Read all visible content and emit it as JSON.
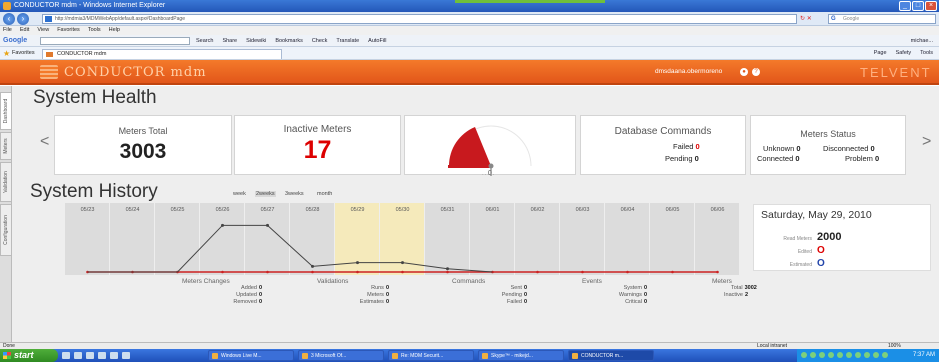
{
  "window": {
    "title": "CONDUCTOR mdm - Windows Internet Explorer"
  },
  "browser": {
    "address": "http://mdmia3/MDMWebApp/default.aspx#DashboardPage",
    "search_placeholder": "Google",
    "menu": [
      "File",
      "Edit",
      "View",
      "Favorites",
      "Tools",
      "Help"
    ],
    "toolbar_logo": "Google",
    "toolbar_items": [
      "Search",
      "Share",
      "Sidewiki",
      "Bookmarks",
      "Check",
      "Translate",
      "AutoFill"
    ],
    "toolbar_user": "michae...",
    "favorites_label": "Favorites",
    "tab_title": "CONDUCTOR mdm",
    "command_items": [
      "Page",
      "Safety",
      "Tools"
    ]
  },
  "app": {
    "brand": "CONDUCTOR mdm",
    "user": "dmsdaana.obermoreno",
    "vendor": "TELVENT",
    "sidebar_tabs": [
      "Dashboard",
      "Meters",
      "Validation",
      "Configuration"
    ]
  },
  "health": {
    "title": "System Health",
    "prev": "<",
    "next": ">",
    "meters_total_label": "Meters Total",
    "meters_total": "3003",
    "inactive_label": "Inactive Meters",
    "inactive": "17",
    "gauge_value": "0",
    "db_label": "Database Commands",
    "db_failed_label": "Failed",
    "db_failed": "0",
    "db_pending_label": "Pending",
    "db_pending": "0",
    "status_label": "Meters Status",
    "unknown_label": "Unknown",
    "unknown": "0",
    "disconnected_label": "Disconnected",
    "disconnected": "0",
    "connected_label": "Connected",
    "connected": "0",
    "problem_label": "Problem",
    "problem": "0"
  },
  "history": {
    "title": "System History",
    "ranges": [
      "week",
      "2weeks",
      "3weeks",
      "month"
    ],
    "active_range": "2weeks",
    "dots": "....."
  },
  "chart_data": {
    "type": "line",
    "x": [
      "05/23",
      "05/24",
      "05/25",
      "05/26",
      "05/27",
      "05/28",
      "05/29",
      "05/30",
      "05/31",
      "06/01",
      "06/02",
      "06/03",
      "06/04",
      "06/05",
      "06/06"
    ],
    "series": [
      {
        "values": [
          0,
          0,
          0,
          5,
          5,
          0.6,
          1,
          1,
          0.35,
          0,
          0,
          0,
          0,
          0,
          0
        ]
      },
      {
        "values": [
          0,
          0,
          0,
          0,
          0,
          0,
          0,
          0,
          0,
          0,
          0,
          0,
          0,
          0,
          0
        ]
      }
    ],
    "highlight": [
      "05/29",
      "05/30"
    ],
    "ylim": [
      0,
      6
    ],
    "grid": true,
    "colors": {
      "line": "#444444",
      "baseline": "#cc2222",
      "highlight": "#f5eabb"
    }
  },
  "day": {
    "date": "Saturday, May 29, 2010",
    "read_label": "Read Meters",
    "read": "2000",
    "edited_label": "Edited",
    "edited": "O",
    "estimated_label": "Estimated",
    "estimated": "O"
  },
  "summary": {
    "meters_changes": {
      "title": "Meters Changes",
      "rows": [
        [
          "Added",
          "0"
        ],
        [
          "Updated",
          "0"
        ],
        [
          "Removed",
          "0"
        ]
      ]
    },
    "validations": {
      "title": "Validations",
      "rows": [
        [
          "Runs",
          "0"
        ],
        [
          "Meters",
          "0"
        ],
        [
          "Estimates",
          "0"
        ]
      ]
    },
    "commands": {
      "title": "Commands",
      "rows": [
        [
          "Sent",
          "0"
        ],
        [
          "Pending",
          "0"
        ],
        [
          "Failed",
          "0"
        ]
      ]
    },
    "events": {
      "title": "Events",
      "rows": [
        [
          "System",
          "0"
        ],
        [
          "Warnings",
          "0"
        ],
        [
          "Critical",
          "0"
        ]
      ]
    },
    "meters": {
      "title": "Meters",
      "rows": [
        [
          "Total",
          "3002"
        ],
        [
          "Inactive",
          "2"
        ]
      ]
    }
  },
  "status": {
    "left": "Done",
    "zone": "Local intranet",
    "zoom": "100%"
  },
  "taskbar": {
    "start": "start",
    "tasks": [
      "Windows Live M...",
      "3 Microsoft Of...",
      "Re: MDM Securit...",
      "Skype™ - mikejd...",
      "CONDUCTOR m..."
    ],
    "clock": "7:37 AM"
  }
}
